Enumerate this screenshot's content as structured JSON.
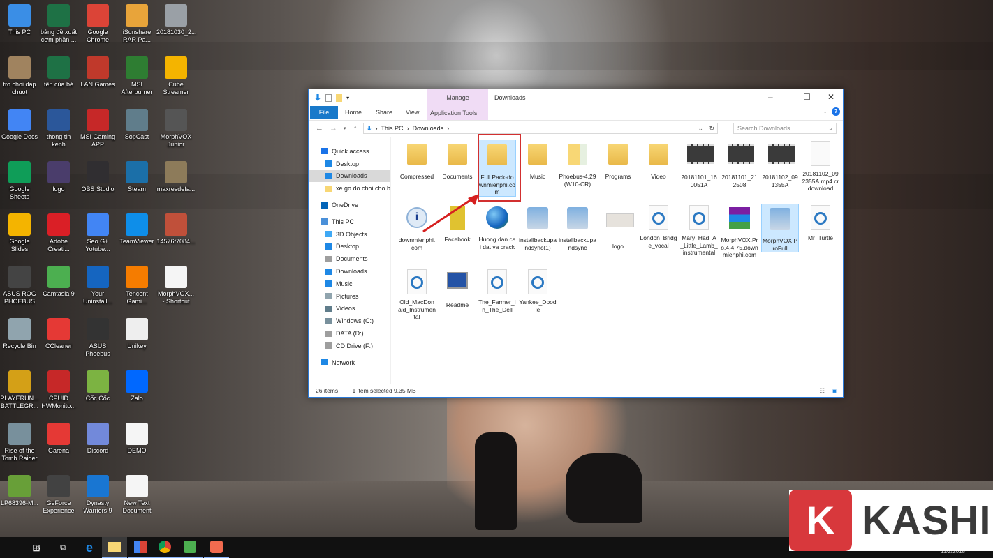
{
  "desktop": {
    "icons": [
      {
        "label": "This PC",
        "col": 0,
        "row": 0,
        "color": "#3a8ee6"
      },
      {
        "label": "bảng đề xuất cơm phần ...",
        "col": 1,
        "row": 0,
        "color": "#1e7145"
      },
      {
        "label": "Google Chrome",
        "col": 2,
        "row": 0,
        "color": "#db4437"
      },
      {
        "label": "iSunshare RAR Pa...",
        "col": 3,
        "row": 0,
        "color": "#e8a43a"
      },
      {
        "label": "20181030_2...",
        "col": 4,
        "row": 0,
        "color": "#9aa0a6"
      },
      {
        "label": "tro choi dap chuot",
        "col": 0,
        "row": 1,
        "color": "#a0835f"
      },
      {
        "label": "tên của bé",
        "col": 1,
        "row": 1,
        "color": "#1e7145"
      },
      {
        "label": "LAN Games",
        "col": 2,
        "row": 1,
        "color": "#c0392b"
      },
      {
        "label": "MSI Afterburner",
        "col": 3,
        "row": 1,
        "color": "#2e7d32"
      },
      {
        "label": "Cube Streamer",
        "col": 4,
        "row": 1,
        "color": "#f4b400"
      },
      {
        "label": "Google Docs",
        "col": 0,
        "row": 2,
        "color": "#4285f4"
      },
      {
        "label": "thong tin kenh",
        "col": 1,
        "row": 2,
        "color": "#2b579a"
      },
      {
        "label": "MSI Gaming APP",
        "col": 2,
        "row": 2,
        "color": "#c62828"
      },
      {
        "label": "SopCast",
        "col": 3,
        "row": 2,
        "color": "#607d8b"
      },
      {
        "label": "MorphVOX Junior",
        "col": 4,
        "row": 2,
        "color": "#555555"
      },
      {
        "label": "Google Sheets",
        "col": 0,
        "row": 3,
        "color": "#0f9d58"
      },
      {
        "label": "logo",
        "col": 1,
        "row": 3,
        "color": "#4a3d6b"
      },
      {
        "label": "OBS Studio",
        "col": 2,
        "row": 3,
        "color": "#302e31"
      },
      {
        "label": "Steam",
        "col": 3,
        "row": 3,
        "color": "#1b6fa8"
      },
      {
        "label": "maxresdefa...",
        "col": 4,
        "row": 3,
        "color": "#8d7b5a"
      },
      {
        "label": "Google Slides",
        "col": 0,
        "row": 4,
        "color": "#f4b400"
      },
      {
        "label": "Adobe Creati...",
        "col": 1,
        "row": 4,
        "color": "#da1f26"
      },
      {
        "label": "Seo G+ Yotube...",
        "col": 2,
        "row": 4,
        "color": "#4285f4"
      },
      {
        "label": "TeamViewer",
        "col": 3,
        "row": 4,
        "color": "#0e8ee9"
      },
      {
        "label": "14576f7084...",
        "col": 4,
        "row": 4,
        "color": "#c0503a"
      },
      {
        "label": "ASUS ROG PHOEBUS",
        "col": 0,
        "row": 5,
        "color": "#444444"
      },
      {
        "label": "Camtasia 9",
        "col": 1,
        "row": 5,
        "color": "#4caf50"
      },
      {
        "label": "Your Uninstall...",
        "col": 2,
        "row": 5,
        "color": "#1565c0"
      },
      {
        "label": "Tencent Gami...",
        "col": 3,
        "row": 5,
        "color": "#f57c00"
      },
      {
        "label": "MorphVOX... - Shortcut",
        "col": 4,
        "row": 5,
        "color": "#f5f5f5"
      },
      {
        "label": "Recycle Bin",
        "col": 0,
        "row": 6,
        "color": "#90a4ae"
      },
      {
        "label": "CCleaner",
        "col": 1,
        "row": 6,
        "color": "#e53935"
      },
      {
        "label": "ASUS Phoebus",
        "col": 2,
        "row": 6,
        "color": "#333333"
      },
      {
        "label": "Unikey",
        "col": 3,
        "row": 6,
        "color": "#eeeeee"
      },
      {
        "label": "PLAYERUN... BATTLEGR...",
        "col": 0,
        "row": 7,
        "color": "#d4a017"
      },
      {
        "label": "CPUID HWMonito...",
        "col": 1,
        "row": 7,
        "color": "#c62828"
      },
      {
        "label": "Cốc Cốc",
        "col": 2,
        "row": 7,
        "color": "#7cb342"
      },
      {
        "label": "Zalo",
        "col": 3,
        "row": 7,
        "color": "#0068ff"
      },
      {
        "label": "Rise of the Tomb Raider",
        "col": 0,
        "row": 8,
        "color": "#78909c"
      },
      {
        "label": "Garena",
        "col": 1,
        "row": 8,
        "color": "#e53935"
      },
      {
        "label": "Discord",
        "col": 2,
        "row": 8,
        "color": "#7289da"
      },
      {
        "label": "DEMO",
        "col": 3,
        "row": 8,
        "color": "#f5f5f5"
      },
      {
        "label": "LP68396-M...",
        "col": 0,
        "row": 9,
        "color": "#689f38"
      },
      {
        "label": "GeForce Experience",
        "col": 1,
        "row": 9,
        "color": "#424242"
      },
      {
        "label": "Dynasty Warriors 9",
        "col": 2,
        "row": 9,
        "color": "#1976d2"
      },
      {
        "label": "New Text Document",
        "col": 3,
        "row": 9,
        "color": "#f5f5f5"
      }
    ]
  },
  "explorer": {
    "title": "Downloads",
    "context_tab_group": "Manage",
    "ribbon_tabs": [
      "File",
      "Home",
      "Share",
      "View"
    ],
    "context_tab": "Application Tools",
    "breadcrumb": [
      "This PC",
      "Downloads"
    ],
    "search_placeholder": "Search Downloads",
    "nav": [
      {
        "label": "Quick access",
        "indent": 0,
        "icon": "star-icon",
        "color": "#1a73e8"
      },
      {
        "label": "Desktop",
        "indent": 1,
        "icon": "desktop-icon",
        "color": "#1e88e5"
      },
      {
        "label": "Downloads",
        "indent": 1,
        "icon": "download-icon",
        "color": "#1e88e5",
        "selected": true
      },
      {
        "label": "xe go do choi cho b",
        "indent": 1,
        "icon": "folder-icon",
        "color": "#f8d775"
      },
      {
        "label": "OneDrive",
        "indent": 0,
        "icon": "cloud-icon",
        "color": "#0364b8",
        "gap": true
      },
      {
        "label": "This PC",
        "indent": 0,
        "icon": "computer-icon",
        "color": "#4a90d9",
        "gap": true
      },
      {
        "label": "3D Objects",
        "indent": 1,
        "icon": "cube-icon",
        "color": "#3fa9f5"
      },
      {
        "label": "Desktop",
        "indent": 1,
        "icon": "desktop-icon",
        "color": "#1e88e5"
      },
      {
        "label": "Documents",
        "indent": 1,
        "icon": "documents-icon",
        "color": "#9e9e9e"
      },
      {
        "label": "Downloads",
        "indent": 1,
        "icon": "download-icon",
        "color": "#1e88e5"
      },
      {
        "label": "Music",
        "indent": 1,
        "icon": "music-icon",
        "color": "#1e88e5"
      },
      {
        "label": "Pictures",
        "indent": 1,
        "icon": "pictures-icon",
        "color": "#90a4ae"
      },
      {
        "label": "Videos",
        "indent": 1,
        "icon": "videos-icon",
        "color": "#607d8b"
      },
      {
        "label": "Windows (C:)",
        "indent": 1,
        "icon": "drive-icon",
        "color": "#78909c"
      },
      {
        "label": "DATA (D:)",
        "indent": 1,
        "icon": "drive-icon",
        "color": "#9e9e9e"
      },
      {
        "label": "CD Drive (F:)",
        "indent": 1,
        "icon": "cd-drive-icon",
        "color": "#9e9e9e"
      },
      {
        "label": "Network",
        "indent": 0,
        "icon": "network-icon",
        "color": "#1e88e5",
        "gap": true
      }
    ],
    "files": [
      {
        "label": "Compressed",
        "kind": "folder"
      },
      {
        "label": "Documents",
        "kind": "folder"
      },
      {
        "label": "Full Pack-downmienphi.com",
        "kind": "folder",
        "highlighted": true
      },
      {
        "label": "Music",
        "kind": "folder"
      },
      {
        "label": "Phoebus-4.29(W10-CR)",
        "kind": "archive"
      },
      {
        "label": "Programs",
        "kind": "folder"
      },
      {
        "label": "Video",
        "kind": "folder"
      },
      {
        "label": "20181101_160051A",
        "kind": "video"
      },
      {
        "label": "20181101_212508",
        "kind": "video"
      },
      {
        "label": "20181102_091355A",
        "kind": "video"
      },
      {
        "label": "20181102_092355A.mp4.crdownload",
        "kind": "doc"
      },
      {
        "label": "downmienphi.com",
        "kind": "info"
      },
      {
        "label": "Facebook",
        "kind": "image"
      },
      {
        "label": "Huong dan cai dat va crack",
        "kind": "web"
      },
      {
        "label": "installbackupandsync(1)",
        "kind": "setup"
      },
      {
        "label": "installbackupandsync",
        "kind": "setup"
      },
      {
        "label": "logo",
        "kind": "imagewide"
      },
      {
        "label": "London_Bridge_vocal",
        "kind": "audio"
      },
      {
        "label": "Mary_Had_A_Little_Lamb_instrumental",
        "kind": "audio"
      },
      {
        "label": "MorphVOX.Pro.4.4.75.downmienphi.com",
        "kind": "rar"
      },
      {
        "label": "MorphVOX ProFull",
        "kind": "setup",
        "selected": true
      },
      {
        "label": "Mr_Turtle",
        "kind": "audio"
      },
      {
        "label": "Old_MacDonald_Instrumental",
        "kind": "audio"
      },
      {
        "label": "Readme",
        "kind": "monitor"
      },
      {
        "label": "The_Farmer_In_The_Dell",
        "kind": "audio"
      },
      {
        "label": "Yankee_Doodle",
        "kind": "audio"
      }
    ],
    "status": {
      "count": "26 items",
      "selection": "1 item selected  9,35 MB"
    }
  },
  "taskbar": {
    "items": [
      "start",
      "search",
      "task-view",
      "edge",
      "file-explorer",
      "seo-g",
      "chrome",
      "camtasia",
      "camtasia-recorder"
    ],
    "clock": "11/2/2018"
  },
  "watermark": {
    "letter": "K",
    "text": "KASHI"
  },
  "colors": {
    "accent": "#1979ca",
    "highlight": "#d23030",
    "selection": "#cce8ff"
  }
}
